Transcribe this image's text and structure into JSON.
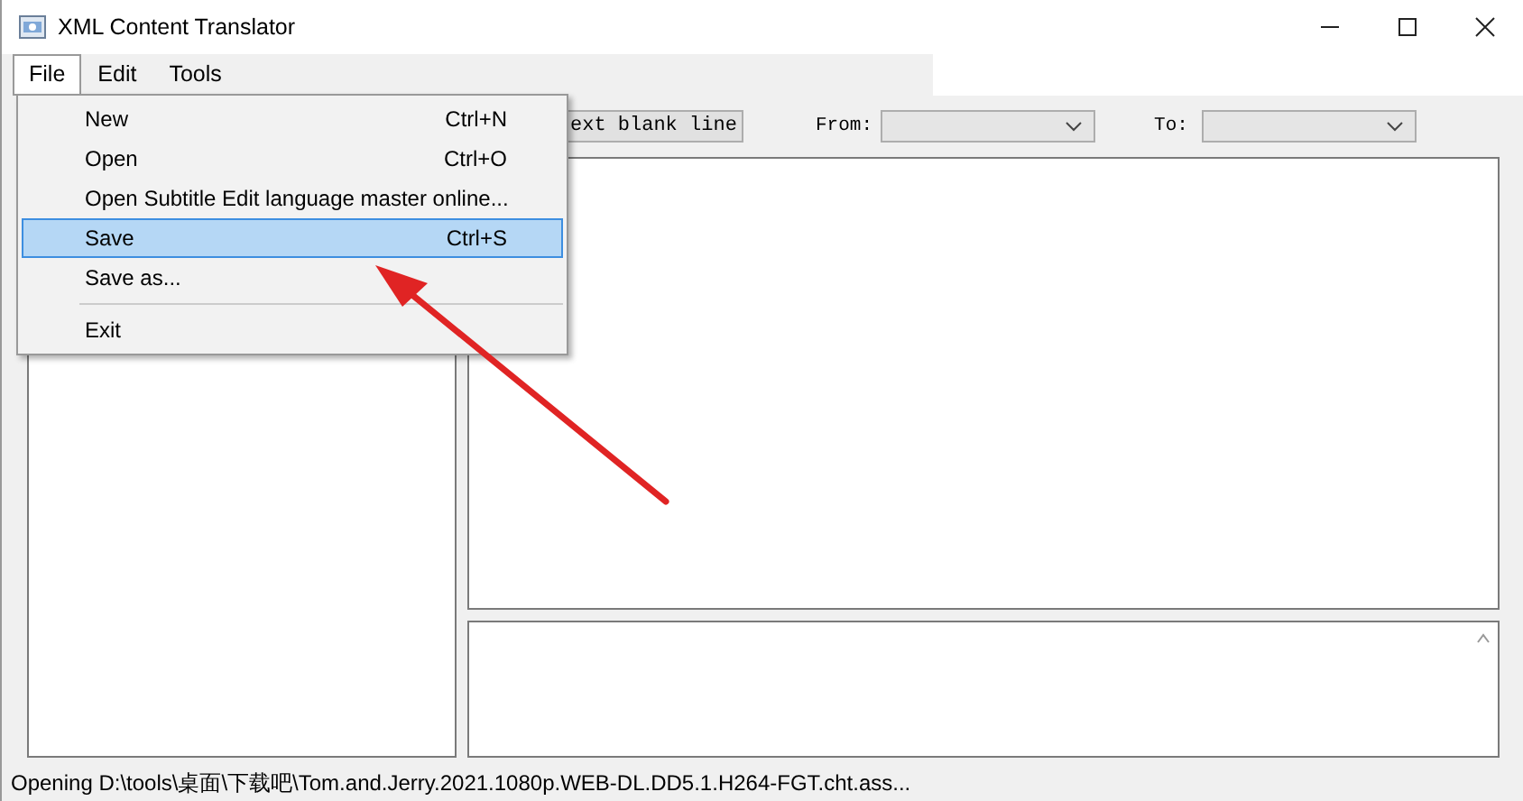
{
  "window": {
    "title": "XML Content Translator"
  },
  "menu_bar": [
    {
      "label": "File",
      "selected": true
    },
    {
      "label": "Edit",
      "selected": false
    },
    {
      "label": "Tools",
      "selected": false
    }
  ],
  "file_menu": [
    {
      "kind": "item",
      "label": "New",
      "shortcut": "Ctrl+N",
      "selected": false
    },
    {
      "kind": "item",
      "label": "Open",
      "shortcut": "Ctrl+O",
      "selected": false
    },
    {
      "kind": "item",
      "label": "Open Subtitle Edit language master online...",
      "selected": false
    },
    {
      "kind": "item",
      "label": "Save",
      "shortcut": "Ctrl+S",
      "selected": true
    },
    {
      "kind": "item",
      "label": "Save as...",
      "selected": false
    },
    {
      "kind": "separator"
    },
    {
      "kind": "item",
      "label": "Exit",
      "selected": false
    }
  ],
  "toolbar": {
    "button": "ext blank line",
    "from_label": "From:",
    "to_label": "To:"
  },
  "status_bar": "Opening D:\\tools\\桌面\\下载吧\\Tom.and.Jerry.2021.1080p.WEB-DL.DD5.1.H264-FGT.cht.ass..."
}
